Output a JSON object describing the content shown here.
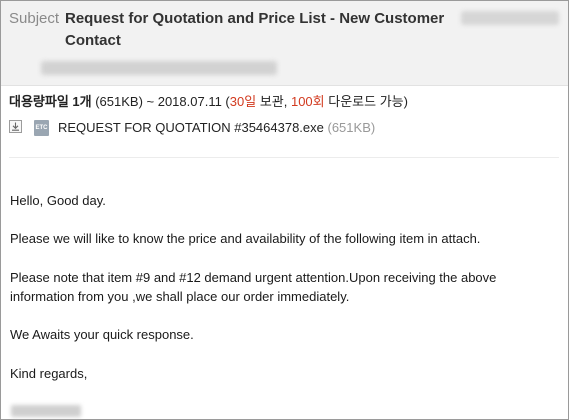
{
  "header": {
    "subject_label": "Subject",
    "subject_title": "Request for Quotation and Price List - New Customer Contact"
  },
  "attachment": {
    "summary_bold": "대용량파일 1개",
    "summary_size": " (651KB) ~ 2018.07.11 (",
    "retention_days": "30일",
    "retention_suffix": " 보관, ",
    "download_count": "100회",
    "download_suffix": " 다운로드 가능)",
    "file_icon_text": "ETC",
    "file_name": "REQUEST FOR QUOTATION #35464378.exe",
    "file_size": "(651KB)"
  },
  "body": {
    "greeting": "Hello, Good day.",
    "p1": "Please we will like to know the price and availability of the following item in attach.",
    "p2": "Please note that item #9 and #12 demand urgent attention.Upon receiving the above information from you ,we shall place our order immediately.",
    "p3": "We Awaits your quick response.",
    "closing": "Kind regards,"
  },
  "colors": {
    "accent_red": "#d23a1f",
    "header_bg": "#f2f2f2"
  }
}
